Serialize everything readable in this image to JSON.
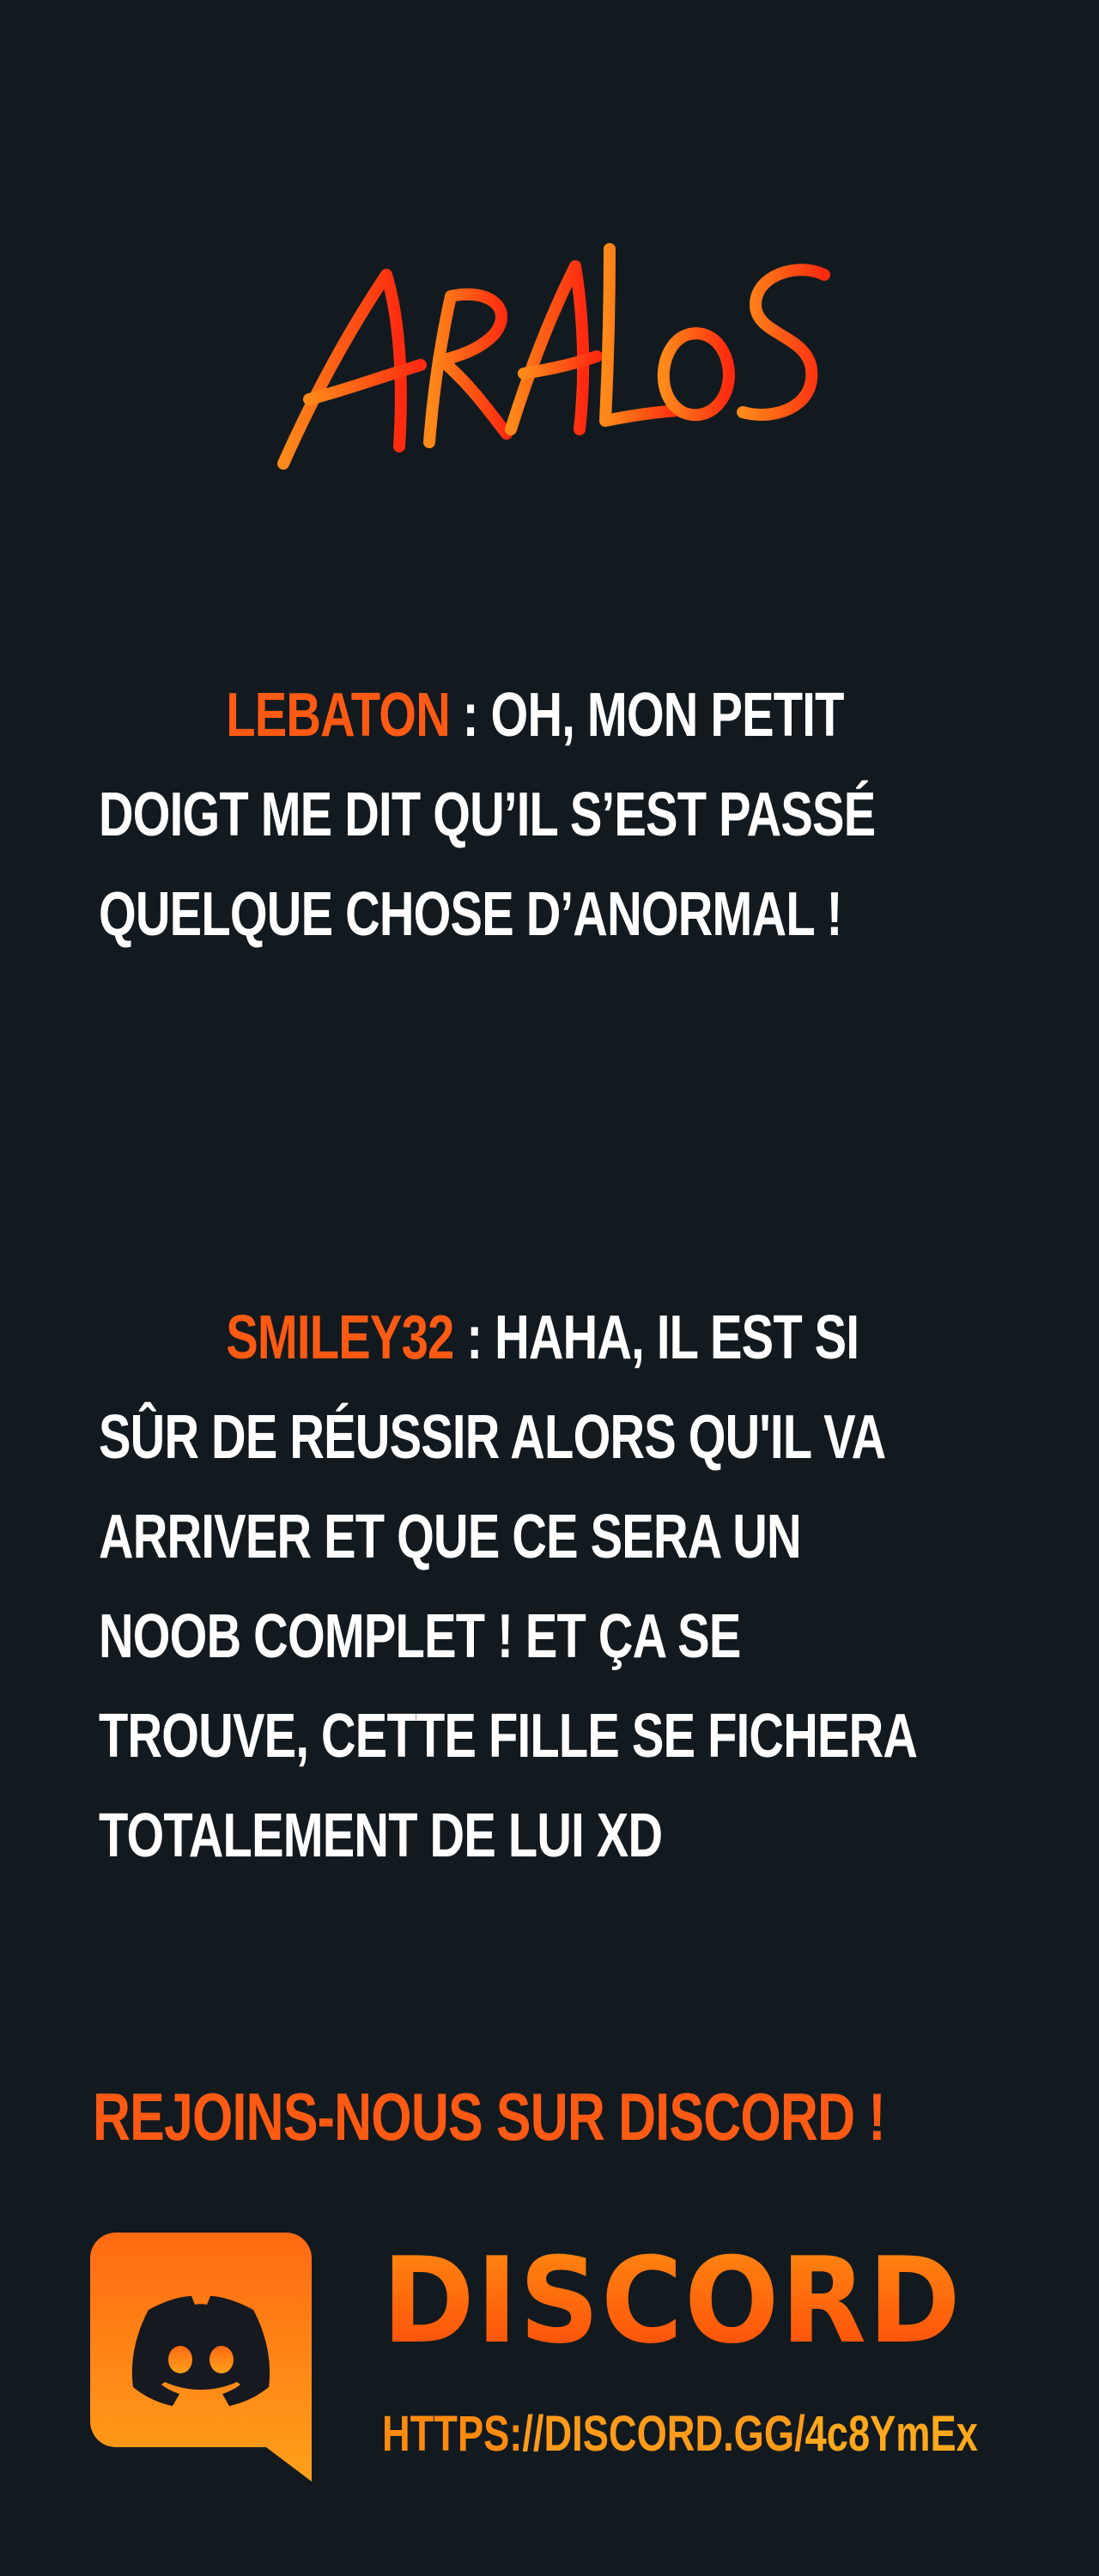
{
  "logo": {
    "text": "ARALOS",
    "gradient_start": "#ff8a1a",
    "gradient_end": "#ff2a10"
  },
  "dialogues": [
    {
      "speaker": "LEBATON",
      "separator": " : ",
      "lines": [
        "OH, MON PETIT",
        "DOIGT ME DIT QU’IL S’EST PASSÉ",
        "QUELQUE CHOSE D’ANORMAL !"
      ]
    },
    {
      "speaker": "SMILEY32",
      "separator": " : ",
      "lines": [
        "HAHA, IL EST SI",
        "SÛR DE RÉUSSIR ALORS QU'IL VA",
        "ARRIVER ET QUE CE SERA UN",
        "NOOB COMPLET ! ET ÇA SE",
        "TROUVE, CETTE FILLE SE FICHERA",
        "TOTALEMENT DE LUI XD"
      ]
    }
  ],
  "cta": {
    "text": "REJOINS-NOUS SUR DISCORD !"
  },
  "discord": {
    "icon": "discord-icon",
    "wordmark": "DISCORD",
    "link_prefix": "HTTPS:",
    "link_rest": "//DISCORD.GG/",
    "link_code": "4c8YmEx"
  },
  "colors": {
    "background": "#121a1f",
    "accent": "#ff5a14",
    "text": "#ffffff"
  }
}
